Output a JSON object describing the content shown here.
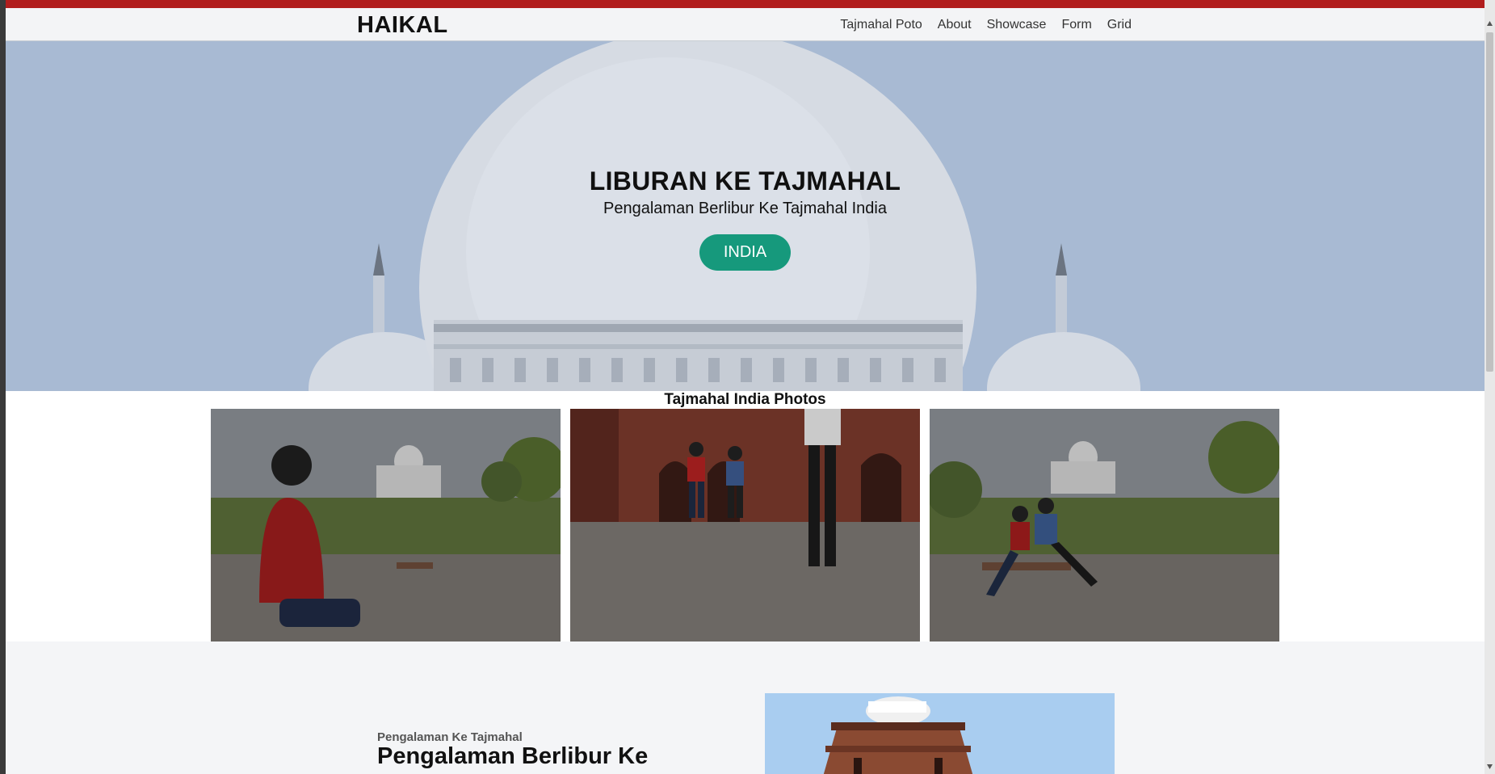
{
  "nav": {
    "brand": "HAIKAL",
    "links": [
      "Tajmahal Poto",
      "About",
      "Showcase",
      "Form",
      "Grid"
    ]
  },
  "hero": {
    "title": "LIBURAN KE TAJMAHAL",
    "subtitle": "Pengalaman Berlibur Ke Tajmahal India",
    "button_label": "INDIA"
  },
  "photos": {
    "title": "Tajmahal India Photos",
    "items": [
      {
        "icon": "photo-man-red-hoodie-tajmahal"
      },
      {
        "icon": "photo-people-running-red-fort"
      },
      {
        "icon": "photo-two-men-bench-tajmahal"
      }
    ]
  },
  "section2": {
    "kicker": "Pengalaman Ke Tajmahal",
    "heading": "Pengalaman Berlibur Ke"
  },
  "colors": {
    "topbar": "#b11d1d",
    "button": "#16997c",
    "navbar_bg": "#f3f4f6"
  }
}
